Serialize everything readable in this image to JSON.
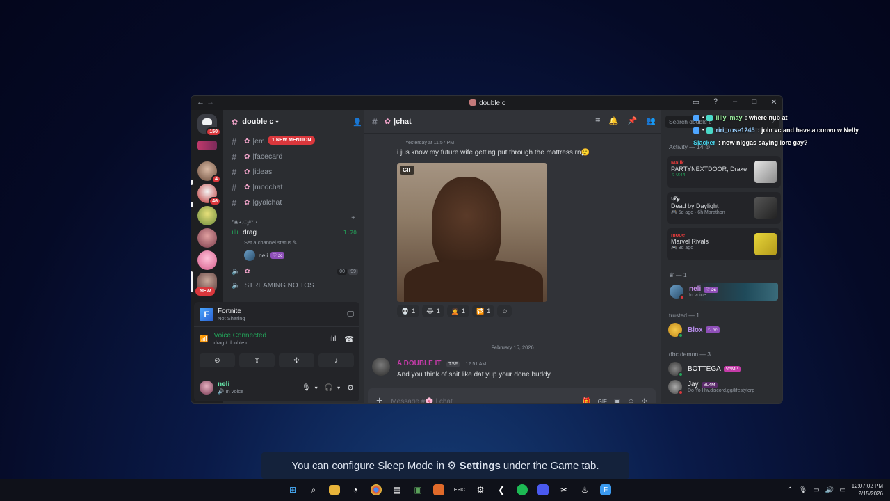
{
  "window": {
    "title": "double c",
    "nav_back": "←",
    "nav_forward": "→",
    "controls": [
      "▭",
      "?",
      "–",
      "□",
      "✕"
    ]
  },
  "guilds": {
    "dm_badge": "150",
    "items": [
      {
        "badge": ""
      },
      {
        "badge": "4"
      },
      {
        "badge": "46"
      },
      {
        "badge": ""
      },
      {
        "badge": ""
      },
      {
        "badge": ""
      },
      {
        "badge": ""
      }
    ],
    "new_label": "NEW"
  },
  "server": {
    "name": "double c",
    "channels": [
      {
        "name": "em",
        "mention": "1 NEW MENTION"
      },
      {
        "name": "facecard"
      },
      {
        "name": "ideas"
      },
      {
        "name": "modchat"
      },
      {
        "name": "gyalchat"
      }
    ],
    "category": "°❀⋆.ೃ࿔*:･",
    "voice_channel": {
      "name": "drag",
      "timer": "1:20",
      "status": "Set a channel status",
      "user": "neli"
    },
    "voice2": {
      "counts": [
        "00",
        "99"
      ]
    },
    "streaming": "STREAMING NO TOS"
  },
  "panel": {
    "game": "Fortnite",
    "game_status": "Not Sharing",
    "voice_connected": "Voice Connected",
    "voice_location": "drag / double c",
    "user": "neli",
    "user_status": "In voice"
  },
  "chat": {
    "channel": "chat",
    "msg1_time": "Yesterday at 11:57 PM",
    "msg1_text": "i jus know my future wife getting put through the mattress rn😮‍💨",
    "gif_label": "GIF",
    "reactions": [
      {
        "emoji": "💀",
        "count": "1"
      },
      {
        "emoji": "😂",
        "count": "1"
      },
      {
        "emoji": "🤦",
        "count": "1"
      },
      {
        "emoji": "🔁",
        "count": "1"
      }
    ],
    "date_divider": "February 15, 2026",
    "msg2_author": "A DOUBLE IT",
    "msg2_tag": "TSF",
    "msg2_time": "12:51 AM",
    "msg2_text": "And you think of shit like dat yup your done buddy",
    "composer_placeholder": "Message #🌸 | chat"
  },
  "members": {
    "search_placeholder": "Search double c",
    "activity_header": "Activity — 14",
    "activities": [
      {
        "name": "Malik",
        "title": "PARTYNEXTDOOR, Drake",
        "sub": "0:44"
      },
      {
        "name": "!𝒯𝓎",
        "title": "Dead by Daylight",
        "sub": "5d ago · 6h Marathon"
      },
      {
        "name": "mooe",
        "title": "Marvel Rivals",
        "sub": "3d ago"
      }
    ],
    "group1": "— 1",
    "neli": {
      "name": "neli",
      "status": "In voice"
    },
    "group2": "trusted — 1",
    "blox": "Blox",
    "group3": "dbc demon — 3",
    "bottega": "BOTTEGA",
    "bottega_tag": "VAMP",
    "jay": "Jay",
    "jay_tag": "BL4M",
    "jay_status": "Do Yo Hw.discord.gg/lifestylerp"
  },
  "overlay": {
    "lines": [
      {
        "user": "lilly_may",
        "text": ": where nub at"
      },
      {
        "user": "riri_rose1245",
        "text": ": join vc and have a convo w Nelly"
      },
      {
        "user": "Slacker",
        "text": ": now niggas saying lore gay?"
      }
    ]
  },
  "toast": {
    "before": "You can configure Sleep Mode in",
    "settings": "Settings",
    "after": "under the Game tab."
  },
  "taskbar": {
    "time": "12:07:02 PM",
    "date": "2/15/2026"
  }
}
